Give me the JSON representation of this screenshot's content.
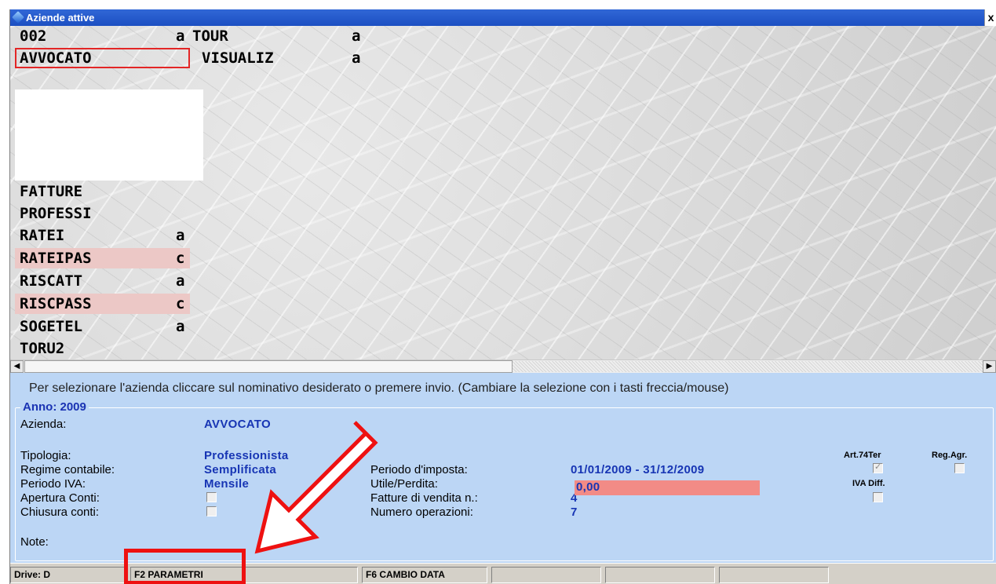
{
  "window": {
    "title": "Aziende attive",
    "close": "x"
  },
  "companies": {
    "col1": [
      {
        "name": "002",
        "flag": "a"
      },
      {
        "name": "AVVOCATO",
        "flag": ""
      },
      {
        "name": "FATTURE",
        "flag": ""
      },
      {
        "name": "PROFESSI",
        "flag": ""
      },
      {
        "name": "RATEI",
        "flag": "a"
      },
      {
        "name": "RATEIPAS",
        "flag": "c"
      },
      {
        "name": "RISCATT",
        "flag": "a"
      },
      {
        "name": "RISCPASS",
        "flag": "c"
      },
      {
        "name": "SOGETEL",
        "flag": "a"
      },
      {
        "name": "TORU2",
        "flag": ""
      }
    ],
    "col2": [
      {
        "name": "TOUR",
        "flag": "a"
      },
      {
        "name": "VISUALIZ",
        "flag": "a"
      }
    ],
    "selected": "AVVOCATO"
  },
  "scrollbar": {
    "left_arrow": "◀",
    "right_arrow": "▶"
  },
  "info": {
    "hint": "Per selezionare l'azienda cliccare sul nominativo desiderato o premere invio. (Cambiare la selezione con i tasti freccia/mouse)",
    "year_legend": "Anno: 2009",
    "azienda_label": "Azienda:",
    "azienda_value": "AVVOCATO",
    "tipologia_label": "Tipologia:",
    "tipologia_value": "Professionista",
    "regime_label": "Regime contabile:",
    "regime_value": "Semplificata",
    "periodo_iva_label": "Periodo IVA:",
    "periodo_iva_value": "Mensile",
    "apertura_label": "Apertura Conti:",
    "chiusura_label": "Chiusura conti:",
    "note_label": "Note:",
    "periodo_imposta_label": "Periodo d'imposta:",
    "periodo_imposta_value": "01/01/2009 - 31/12/2009",
    "utile_label": "Utile/Perdita:",
    "utile_value": "0,00",
    "fatture_label": "Fatture di vendita n.:",
    "fatture_value": "4",
    "operazioni_label": "Numero operazioni:",
    "operazioni_value": "7",
    "art74_label": "Art.74Ter",
    "regagr_label": "Reg.Agr.",
    "ivadiff_label": "IVA Diff.",
    "art74_checked": true,
    "regagr_checked": false,
    "ivadiff_checked": false,
    "apertura_checked": false,
    "chiusura_checked": false
  },
  "statusbar": {
    "drive": "Drive: D",
    "f2": "F2 PARAMETRI",
    "f6": "F6 CAMBIO DATA"
  },
  "colors": {
    "selection_border": "#e32626",
    "highlight_pink": "#ecc8c6",
    "utile_bg": "#f28b86",
    "annotation_red": "#ee1111",
    "info_bg": "#bcd6f5"
  }
}
